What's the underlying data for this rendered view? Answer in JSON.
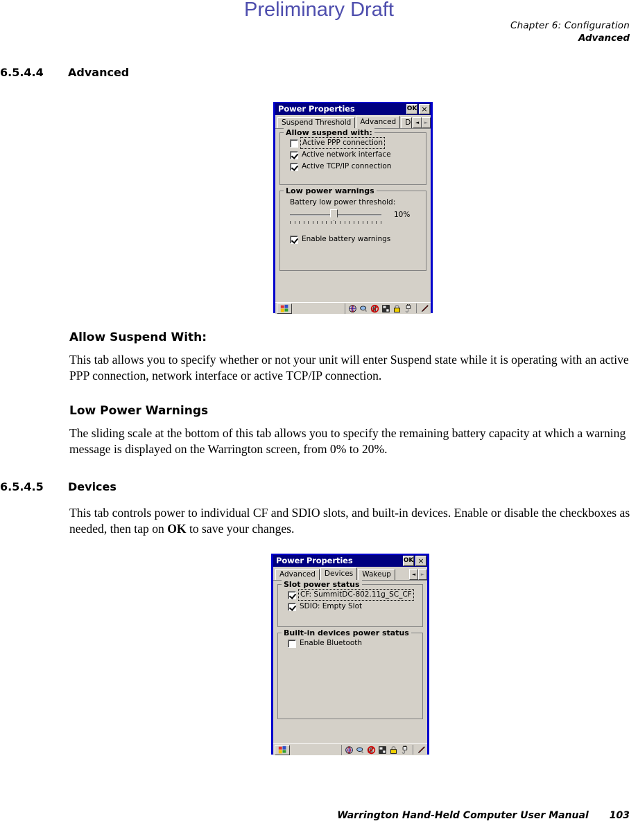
{
  "page": {
    "watermark": "Preliminary Draft",
    "header_chapter": "Chapter 6: Configuration",
    "header_section": "Advanced",
    "footer_title": "Warrington Hand-Held Computer User Manual",
    "footer_page": "103"
  },
  "sections": [
    {
      "number": "6.5.4.4",
      "title": "Advanced",
      "subheads": [
        {
          "title": "Allow Suspend With:",
          "body": "This tab allows you to specify whether or not your unit will enter Suspend state while it is operating with an active PPP connection, network interface or active TCP/IP connection."
        },
        {
          "title": "Low Power Warnings",
          "body": "The sliding scale at the bottom of this tab allows you to specify the remaining battery capacity at which a warning message is displayed on the Warrington screen, from 0% to 20%."
        }
      ]
    },
    {
      "number": "6.5.4.5",
      "title": "Devices",
      "body_pre": "This tab controls power to individual CF and SDIO slots, and built-in devices. Enable or disable the checkboxes as needed, then tap on ",
      "body_bold": "OK",
      "body_post": " to save your changes."
    }
  ],
  "dialog_advanced": {
    "title": "Power Properties",
    "ok_label": "OK",
    "close_label": "×",
    "tabs": [
      {
        "label": "Suspend Threshold",
        "selected": false
      },
      {
        "label": "Advanced",
        "selected": true
      },
      {
        "label": "De",
        "selected": false
      }
    ],
    "spin_left": "◄",
    "spin_right": "►",
    "group_suspend": {
      "label": "Allow suspend with:",
      "items": [
        {
          "label": "Active PPP connection",
          "checked": false,
          "focused": true,
          "accel": "P"
        },
        {
          "label": "Active network interface",
          "checked": true,
          "focused": false,
          "accel": "n"
        },
        {
          "label": "Active TCP/IP connection",
          "checked": true,
          "focused": false,
          "accel": "T"
        }
      ]
    },
    "group_lowpower": {
      "label": "Low power warnings",
      "threshold_label": "Battery low power threshold:",
      "threshold_value": "10%",
      "slider_position_percent": 45,
      "enable_warnings": {
        "label": "Enable battery warnings",
        "checked": true,
        "accel": "E"
      }
    }
  },
  "dialog_devices": {
    "title": "Power Properties",
    "ok_label": "OK",
    "close_label": "×",
    "tabs": [
      {
        "label": "Advanced",
        "selected": false
      },
      {
        "label": "Devices",
        "selected": true
      },
      {
        "label": "Wakeup",
        "selected": false
      }
    ],
    "spin_left": "◄",
    "spin_right": "►",
    "group_slot": {
      "label": "Slot power status",
      "items": [
        {
          "label": "CF: SummitDC-802.11g_SC_CF",
          "checked": true,
          "focused": true,
          "accel": "C"
        },
        {
          "label": "SDIO: Empty Slot",
          "checked": true,
          "focused": false,
          "accel": "S"
        }
      ]
    },
    "group_builtin": {
      "label": "Built-in devices power status",
      "items": [
        {
          "label": "Enable Bluetooth",
          "checked": false,
          "focused": false,
          "accel": ""
        }
      ]
    }
  },
  "taskbar": {
    "start_icon": "windows-start-icon",
    "tray_icons": [
      "network-globe-icon",
      "volume-speaker-icon",
      "wireless-disabled-icon",
      "storage-card-icon",
      "security-lock-icon",
      "power-plug-icon",
      "stylus-pen-icon"
    ]
  },
  "colors": {
    "watermark": "#4d4dad",
    "titlebar": "#000080",
    "window_border": "#0000cc",
    "face": "#d4d0c8"
  }
}
